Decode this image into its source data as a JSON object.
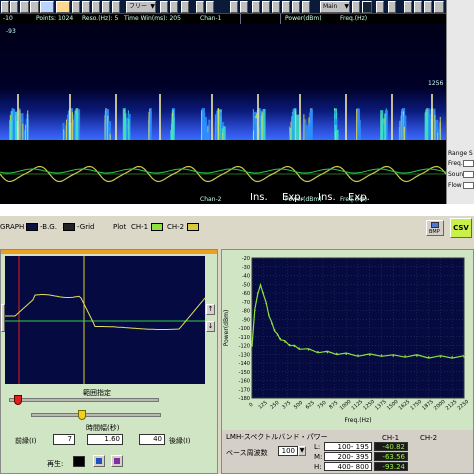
{
  "toolbar": {
    "menu1": "フリー",
    "menu2": "Main"
  },
  "info_row": {
    "val1": "-10",
    "points": "Points: 1024",
    "resol": "Reso.(Hz): 5",
    "time_win": "Time Win(ms): 205",
    "chan": "Chan-1",
    "power": "Power(dBm)",
    "freq": "Freq.(Hz)"
  },
  "spectrogram": {
    "top_value": "-93",
    "top_right_label": "1256",
    "chan_label": "Chan-2",
    "power2": "Power(dBm)",
    "freq2": "Freq.(Hz)",
    "annotations": [
      "Ins.",
      "Exp.",
      "Ins.",
      "Exp."
    ]
  },
  "right_strip": {
    "title": "Range S",
    "items": [
      "Freq.",
      "Sound",
      "Flow"
    ]
  },
  "legend": {
    "graph": "GRAPH",
    "bg": "-B.G.",
    "grid": "-Grid",
    "plot": "Plot",
    "ch1": "CH-1",
    "ch2": "CH-2",
    "colors": {
      "bg": "#0a1040",
      "grid": "#222222",
      "ch1": "#8ce040",
      "ch2": "#d8c840"
    }
  },
  "top_right_buttons": {
    "bmp": "BMP",
    "csv": "CSV"
  },
  "left_pane": {
    "range_label": "範囲指定",
    "time_label": "時間幅(秒)",
    "before_label": "前縁(I)",
    "before_value": "7",
    "time_value": "1.60",
    "after_value": "40",
    "after_label": "後縁(I)",
    "play_label": "再生:"
  },
  "chart_data": {
    "type": "line",
    "title": "",
    "xlabel": "Freq.(Hz)",
    "ylabel": "Power(dBm)",
    "xlim": [
      0,
      2250
    ],
    "ylim": [
      -180,
      -20
    ],
    "x_ticks": [
      "0",
      "125",
      "250",
      "375",
      "500",
      "625",
      "750",
      "875",
      "1000",
      "1125",
      "1250",
      "1375",
      "1500",
      "1625",
      "1750",
      "1875",
      "2000",
      "2125",
      "2250"
    ],
    "y_ticks": [
      "-20",
      "-30",
      "-40",
      "-50",
      "-60",
      "-70",
      "-80",
      "-90",
      "-100",
      "-110",
      "-120",
      "-130",
      "-140",
      "-150",
      "-160",
      "-170",
      "-180"
    ],
    "series": [
      {
        "x": [
          0,
          30,
          60,
          90,
          120,
          150,
          180,
          210,
          240,
          270,
          300,
          350,
          400,
          450,
          500,
          600,
          700,
          800,
          900,
          1000,
          1125,
          1250,
          1375,
          1500,
          1625,
          1750,
          1875,
          2000,
          2125,
          2250
        ],
        "values": [
          -120,
          -80,
          -60,
          -52,
          -60,
          -72,
          -85,
          -95,
          -102,
          -108,
          -112,
          -116,
          -119,
          -121,
          -123,
          -125,
          -127,
          -128,
          -129,
          -130,
          -131,
          -131,
          -131,
          -132,
          -132,
          -132,
          -133,
          -133,
          -133,
          -133
        ]
      }
    ]
  },
  "lmh": {
    "title": "LMH-スペクトルバンド・パワー",
    "base_label": "ベース周波数",
    "base_value": "100",
    "col1": "CH-1",
    "col2": "CH-2",
    "rows": [
      {
        "name": "L:",
        "range": "100- 195",
        "ch1": "-40.82"
      },
      {
        "name": "M:",
        "range": "200- 395",
        "ch1": "-63.56"
      },
      {
        "name": "H:",
        "range": "400- 800",
        "ch1": "-93.24"
      }
    ]
  }
}
